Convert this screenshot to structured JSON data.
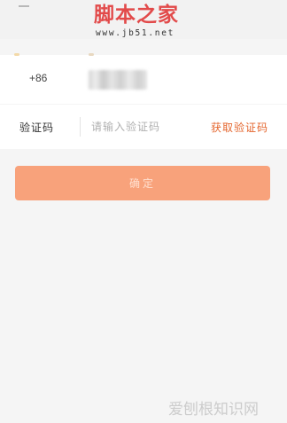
{
  "watermark": {
    "title": "脚本之家",
    "url": "www.jb51.net"
  },
  "phone": {
    "country_code": "+86"
  },
  "verification": {
    "label": "验证码",
    "placeholder": "请输入验证码",
    "get_code_label": "获取验证码"
  },
  "confirm": {
    "label": "确定"
  },
  "footer_watermark": {
    "text": "爱刨根知识网"
  },
  "colors": {
    "accent": "#e4662e",
    "button_bg": "#f8a27b",
    "page_bg": "#f5f5f5"
  }
}
